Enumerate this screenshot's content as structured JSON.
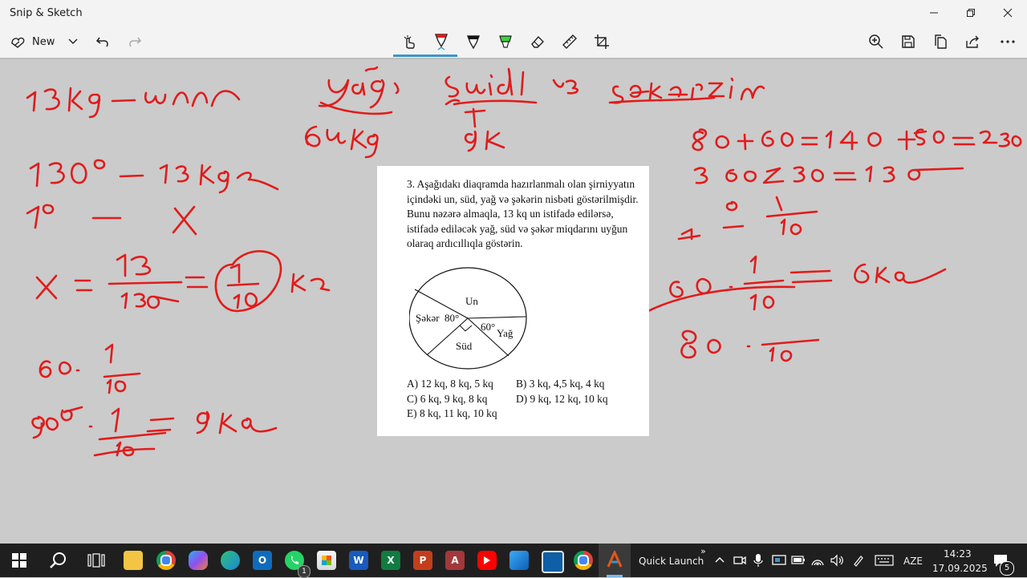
{
  "window": {
    "title": "Snip & Sketch"
  },
  "toolbar": {
    "new_label": "New"
  },
  "document": {
    "question": "3. Aşağıdakı diaqramda hazırlanmalı olan şirniyyatın içindəki un, süd, yağ və şəkərin nisbəti göstərilmişdir. Bunu nəzərə almaqla, 13 kq un istifadə edilərsə, istifadə ediləcək yağ, süd və şəkər miqdarını uyğun olaraq ardıcıllıqla göstərin.",
    "pie_labels": {
      "un": "Un",
      "seker": "Şəkər",
      "seker_angle": "80°",
      "yag_angle": "60°",
      "yag": "Yağ",
      "sud": "Süd"
    },
    "answers": {
      "a": "A) 12 kq, 8 kq, 5 kq",
      "b": "B) 3 kq, 4,5 kq, 4 kq",
      "c": "C) 6 kq, 9 kq, 8 kq",
      "d": "D) 9 kq, 12 kq, 10 kq",
      "e": "E) 8 kq, 11 kq, 10 kq"
    }
  },
  "ink": {
    "color": "#e21b1b"
  },
  "taskbar": {
    "quick_launch": "Quick Launch",
    "language": "AZE",
    "time": "14:23",
    "date": "17.09.2025",
    "notification_count": "5",
    "outlook_badge": "1",
    "icons": [
      "windows-start-icon",
      "search-icon",
      "task-view-icon",
      "file-explorer-icon",
      "chrome-icon",
      "copilot-icon",
      "edge-icon",
      "outlook-icon",
      "whatsapp-icon",
      "store-icon",
      "word-icon",
      "excel-icon",
      "powerpoint-icon",
      "access-icon",
      "youtube-icon",
      "paint-icon",
      "snipping-tool-icon",
      "chrome-profile-icon",
      "snip-sketch-icon"
    ]
  }
}
